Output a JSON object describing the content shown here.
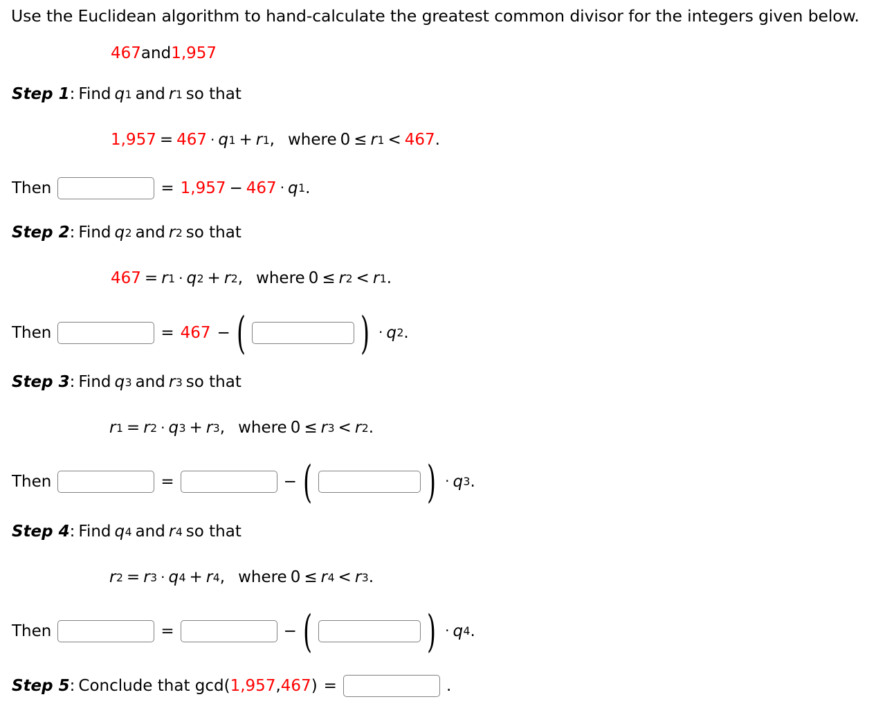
{
  "prompt": "Use the Euclidean algorithm to hand-calculate the greatest common divisor for the integers given below.",
  "integers": {
    "a": "467",
    "and": " and ",
    "b": "1,957"
  },
  "colors": {
    "red": "#ff0000",
    "text": "#000000",
    "box_border": "#808080"
  },
  "steps": [
    {
      "label": "Step 1",
      "colon": ":",
      "find_text": "Find",
      "q": "q",
      "q_sub": "1",
      "and": "and",
      "r": "r",
      "r_sub": "1",
      "so_that": "so that",
      "equation": {
        "lhs": "1,957",
        "eq": "=",
        "term1": "467",
        "dot": "·",
        "q": "q",
        "q_sub": "1",
        "plus": "+",
        "r": "r",
        "r_sub": "1",
        "comma": ",",
        "where": "where",
        "zero": "0",
        "le": "≤",
        "bound_r": "r",
        "bound_r_sub": "1",
        "lt": "<",
        "bound": "467",
        "period": "."
      },
      "then": {
        "then_label": "Then",
        "input1_value": "",
        "eq": "=",
        "a": "1,957",
        "minus": "−",
        "b": "467",
        "dot": "·",
        "q": "q",
        "q_sub": "1",
        "period": "."
      }
    },
    {
      "label": "Step 2",
      "colon": ":",
      "find_text": "Find",
      "q": "q",
      "q_sub": "2",
      "and": "and",
      "r": "r",
      "r_sub": "2",
      "so_that": "so that",
      "equation": {
        "lhs": "467",
        "eq": "=",
        "term1_r": "r",
        "term1_sub": "1",
        "dot": "·",
        "q": "q",
        "q_sub": "2",
        "plus": "+",
        "r": "r",
        "r_sub": "2",
        "comma": ",",
        "where": "where",
        "zero": "0",
        "le": "≤",
        "bound_r": "r",
        "bound_r_sub": "2",
        "lt": "<",
        "bound_r2": "r",
        "bound_r2_sub": "1",
        "period": "."
      },
      "then": {
        "then_label": "Then",
        "input1_value": "",
        "eq": "=",
        "a": "467",
        "minus": "−",
        "lparen": "(",
        "input2_value": "",
        "rparen": ")",
        "dot": "·",
        "q": "q",
        "q_sub": "2",
        "period": "."
      }
    },
    {
      "label": "Step 3",
      "colon": ":",
      "find_text": "Find",
      "q": "q",
      "q_sub": "3",
      "and": "and",
      "r": "r",
      "r_sub": "3",
      "so_that": "so that",
      "equation": {
        "lhs_r": "r",
        "lhs_sub": "1",
        "eq": "=",
        "term1_r": "r",
        "term1_sub": "2",
        "dot": "·",
        "q": "q",
        "q_sub": "3",
        "plus": "+",
        "r": "r",
        "r_sub": "3",
        "comma": ",",
        "where": "where",
        "zero": "0",
        "le": "≤",
        "bound_r": "r",
        "bound_r_sub": "3",
        "lt": "<",
        "bound_r2": "r",
        "bound_r2_sub": "2",
        "period": "."
      },
      "then": {
        "then_label": "Then",
        "input1_value": "",
        "eq": "=",
        "input2_value": "",
        "minus": "−",
        "lparen": "(",
        "input3_value": "",
        "rparen": ")",
        "dot": "·",
        "q": "q",
        "q_sub": "3",
        "period": "."
      }
    },
    {
      "label": "Step 4",
      "colon": ":",
      "find_text": "Find",
      "q": "q",
      "q_sub": "4",
      "and": "and",
      "r": "r",
      "r_sub": "4",
      "so_that": "so that",
      "equation": {
        "lhs_r": "r",
        "lhs_sub": "2",
        "eq": "=",
        "term1_r": "r",
        "term1_sub": "3",
        "dot": "·",
        "q": "q",
        "q_sub": "4",
        "plus": "+",
        "r": "r",
        "r_sub": "4",
        "comma": ",",
        "where": "where",
        "zero": "0",
        "le": "≤",
        "bound_r": "r",
        "bound_r_sub": "4",
        "lt": "<",
        "bound_r2": "r",
        "bound_r2_sub": "3",
        "period": "."
      },
      "then": {
        "then_label": "Then",
        "input1_value": "",
        "eq": "=",
        "input2_value": "",
        "minus": "−",
        "lparen": "(",
        "input3_value": "",
        "rparen": ")",
        "dot": "·",
        "q": "q",
        "q_sub": "4",
        "period": "."
      }
    }
  ],
  "step5": {
    "label": "Step 5",
    "colon": ":",
    "conclude": "Conclude that gcd(",
    "a": "1,957",
    "comma": ", ",
    "b": "467",
    "close": ")",
    "eq": "=",
    "input_value": "",
    "period": "."
  }
}
